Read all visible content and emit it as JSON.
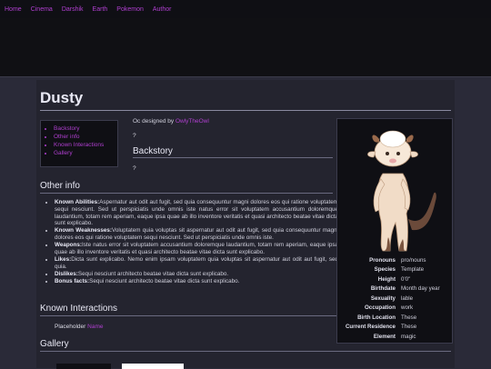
{
  "nav": {
    "items": [
      "Home",
      "Cinema",
      "Darshik",
      "Earth",
      "Pokemon",
      "Author"
    ]
  },
  "page": {
    "title": "Dusty"
  },
  "toc": {
    "items": [
      "Backstory",
      "Other info",
      "Known Interactions",
      "Gallery"
    ]
  },
  "intro": {
    "prefix": "Oc designed by",
    "designer": "OwlyTheOwl",
    "placeholder": "?"
  },
  "backstory": {
    "heading": "Backstory",
    "text": "?"
  },
  "other_info": {
    "heading": "Other info",
    "items": [
      {
        "label": "Known Abilities:",
        "text": "Aspernatur aut odit aut fugit, sed quia consequuntur magni dolores eos qui ratione voluptatem sequi nesciunt. Sed ut perspiciatis unde omnis iste natus error sit voluptatem accusantium doloremque laudantium, totam rem aperiam, eaque ipsa quae ab illo inventore veritatis et quasi architecto beatae vitae dicta sunt explicabo."
      },
      {
        "label": "Known Weaknesses:",
        "text": "Voluptatem quia voluptas sit aspernatur aut odit aut fugit, sed quia consequuntur magni dolores eos qui ratione voluptatem sequi nesciunt. Sed ut perspiciatis unde omnis iste."
      },
      {
        "label": "Weapons:",
        "text": "Iste natus error sit voluptatem accusantium doloremque laudantium, totam rem aperiam, eaque ipsa quae ab illo inventore veritatis et quasi architecto beatae vitae dicta sunt explicabo."
      },
      {
        "label": "Likes:",
        "text": "Dicta sunt explicabo. Nemo enim ipsam voluptatem quia voluptas sit aspernatur aut odit aut fugit, sed quia."
      },
      {
        "label": "Dislikes:",
        "text": "Sequi nesciunt architecto beatae vitae dicta sunt explicabo."
      },
      {
        "label": "Bonus facts:",
        "text": "Sequi nesciunt architecto beatae vitae dicta sunt explicabo."
      }
    ]
  },
  "known_interactions": {
    "heading": "Known Interactions",
    "prefix": "Placeholder",
    "name": "Name"
  },
  "gallery": {
    "heading": "Gallery"
  },
  "infobox": {
    "rows": [
      {
        "k": "Pronouns",
        "v": "pro/nouns"
      },
      {
        "k": "Species",
        "v": "Template"
      },
      {
        "k": "Height",
        "v": "0'0\""
      },
      {
        "k": "Birthdate",
        "v": "Month day year"
      },
      {
        "k": "Sexuality",
        "v": "lable"
      },
      {
        "k": "Occupation",
        "v": "work"
      },
      {
        "k": "Birth Location",
        "v": "These"
      },
      {
        "k": "Current Residence",
        "v": "These"
      },
      {
        "k": "Element",
        "v": "magic"
      }
    ]
  },
  "colors": {
    "accent": "#b03fd0",
    "background": "#2a2a38",
    "panel": "#0f0f14"
  }
}
